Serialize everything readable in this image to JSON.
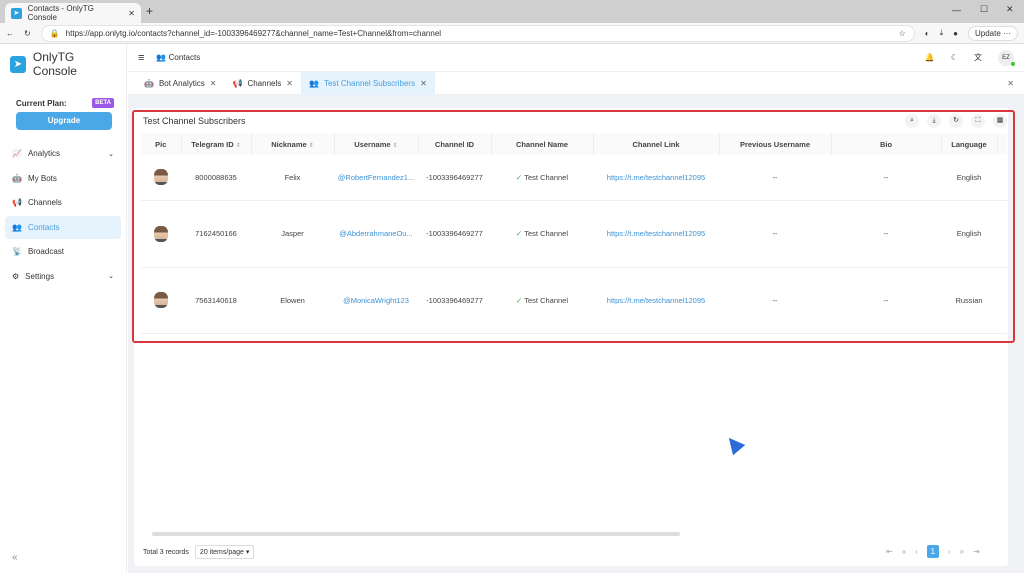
{
  "browser": {
    "tab_title": "Contacts - OnlyTG Console",
    "new_tab": "+",
    "url": "https://app.onlytg.io/contacts?channel_id=-1003396469277&channel_name=Test+Channel&from=channel",
    "update_label": "Update",
    "more": "···"
  },
  "sidebar": {
    "app_name": "OnlyTG Console",
    "plan_label": "Current Plan:",
    "plan_badge": "BETA",
    "upgrade_label": "Upgrade",
    "items": [
      {
        "label": "Analytics",
        "icon": "📈"
      },
      {
        "label": "My Bots",
        "icon": "🤖"
      },
      {
        "label": "Channels",
        "icon": "📢"
      },
      {
        "label": "Contacts",
        "icon": "👥"
      },
      {
        "label": "Broadcast",
        "icon": "📡"
      },
      {
        "label": "Settings",
        "icon": "⚙"
      }
    ],
    "collapse": "«"
  },
  "header": {
    "menu": "≡",
    "breadcrumb": "Contacts",
    "avatar": "EZ"
  },
  "page_tabs": [
    {
      "label": "Bot Analytics"
    },
    {
      "label": "Channels"
    },
    {
      "label": "Test Channel Subscribers"
    }
  ],
  "card": {
    "title": "Test Channel Subscribers"
  },
  "table": {
    "columns": [
      "Pic",
      "Telegram ID",
      "Nickname",
      "Username",
      "Channel ID",
      "Channel Name",
      "Channel Link",
      "Previous Username",
      "Bio",
      "Language"
    ],
    "rows": [
      {
        "telegram_id": "8000088635",
        "nickname": "Felix",
        "username": "@RobertFernandez1...",
        "channel_id": "-1003396469277",
        "channel_name": "Test Channel",
        "channel_link": "https://t.me/testchannel12095",
        "previous_username": "--",
        "bio": "--",
        "language": "English"
      },
      {
        "telegram_id": "7162450166",
        "nickname": "Jasper",
        "username": "@AbderrahmaneOu...",
        "channel_id": "-1003396469277",
        "channel_name": "Test Channel",
        "channel_link": "https://t.me/testchannel12095",
        "previous_username": "--",
        "bio": "--",
        "language": "English"
      },
      {
        "telegram_id": "7563140618",
        "nickname": "Elowen",
        "username": "@MonicaWright123",
        "channel_id": "-1003396469277",
        "channel_name": "Test Channel",
        "channel_link": "https://t.me/testchannel12095",
        "previous_username": "--",
        "bio": "--",
        "language": "Russian"
      }
    ]
  },
  "footer": {
    "total": "Total 3 records",
    "page_size": "20 items/page",
    "current_page": "1"
  }
}
